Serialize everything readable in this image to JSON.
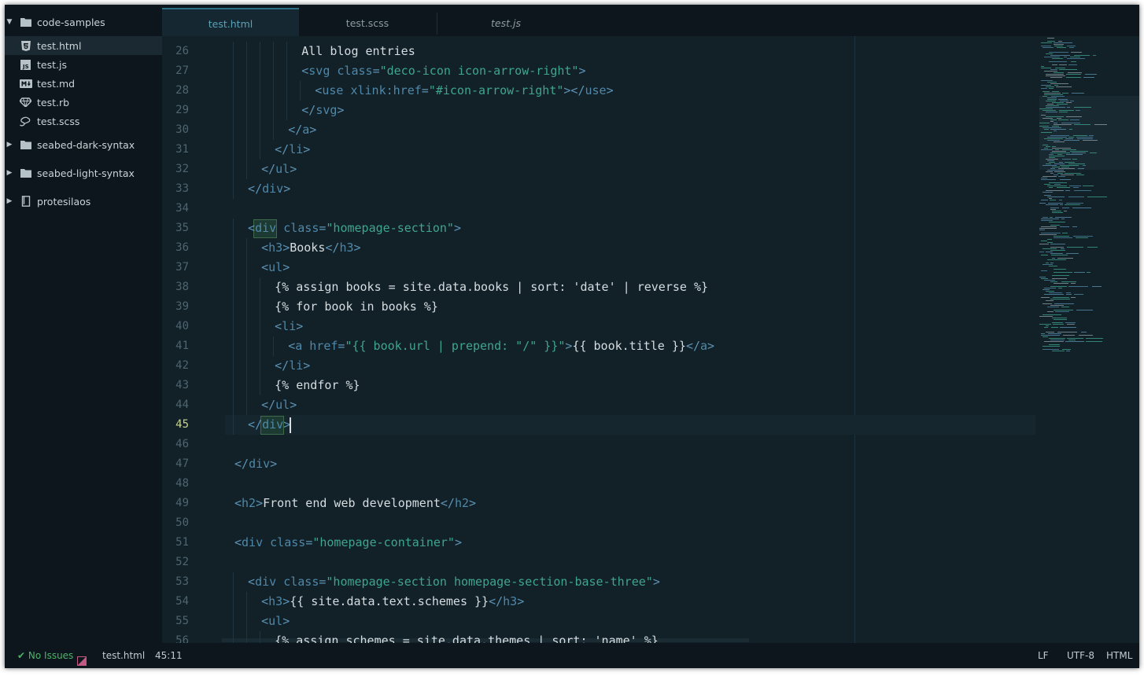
{
  "sidebar": {
    "root": {
      "label": "code-samples",
      "icon": "folder-icon",
      "expanded": true
    },
    "files": [
      {
        "label": "test.html",
        "icon": "html5-icon",
        "selected": true
      },
      {
        "label": "test.js",
        "icon": "js-icon",
        "selected": false
      },
      {
        "label": "test.md",
        "icon": "markdown-icon",
        "selected": false
      },
      {
        "label": "test.rb",
        "icon": "ruby-icon",
        "selected": false
      },
      {
        "label": "test.scss",
        "icon": "sass-icon",
        "selected": false
      }
    ],
    "folders": [
      {
        "label": "seabed-dark-syntax",
        "icon": "folder-icon"
      },
      {
        "label": "seabed-light-syntax",
        "icon": "folder-icon"
      },
      {
        "label": "protesilaos",
        "icon": "repo-icon"
      }
    ]
  },
  "tabs": [
    {
      "label": "test.html",
      "active": true
    },
    {
      "label": "test.scss",
      "active": false
    },
    {
      "label": "test.js",
      "active": false
    }
  ],
  "editor": {
    "current_line": 45,
    "lines": [
      {
        "n": "26",
        "indent": 5,
        "tokens": [
          [
            "t",
            "All blog entries"
          ]
        ]
      },
      {
        "n": "27",
        "indent": 5,
        "tokens": [
          [
            "b",
            "<"
          ],
          [
            "g",
            "svg"
          ],
          [
            "a",
            " class"
          ],
          [
            "b",
            "="
          ],
          [
            "s",
            "\"deco-icon icon-arrow-right\""
          ],
          [
            "b",
            ">"
          ]
        ]
      },
      {
        "n": "28",
        "indent": 6,
        "tokens": [
          [
            "b",
            "<"
          ],
          [
            "g",
            "use"
          ],
          [
            "a",
            " xlink:href"
          ],
          [
            "b",
            "="
          ],
          [
            "s",
            "\"#icon-arrow-right\""
          ],
          [
            "b",
            "></"
          ],
          [
            "g",
            "use"
          ],
          [
            "b",
            ">"
          ]
        ]
      },
      {
        "n": "29",
        "indent": 5,
        "tokens": [
          [
            "b",
            "</"
          ],
          [
            "g",
            "svg"
          ],
          [
            "b",
            ">"
          ]
        ]
      },
      {
        "n": "30",
        "indent": 4,
        "tokens": [
          [
            "b",
            "</"
          ],
          [
            "g",
            "a"
          ],
          [
            "b",
            ">"
          ]
        ]
      },
      {
        "n": "31",
        "indent": 3,
        "tokens": [
          [
            "b",
            "</"
          ],
          [
            "g",
            "li"
          ],
          [
            "b",
            ">"
          ]
        ]
      },
      {
        "n": "32",
        "indent": 2,
        "tokens": [
          [
            "b",
            "</"
          ],
          [
            "g",
            "ul"
          ],
          [
            "b",
            ">"
          ]
        ]
      },
      {
        "n": "33",
        "indent": 1,
        "tokens": [
          [
            "b",
            "</"
          ],
          [
            "g",
            "div"
          ],
          [
            "b",
            ">"
          ]
        ]
      },
      {
        "n": "34",
        "indent": 0,
        "tokens": []
      },
      {
        "n": "35",
        "indent": 1,
        "tokens": [
          [
            "b",
            "<"
          ],
          [
            "g",
            "div"
          ],
          [
            "a",
            " class"
          ],
          [
            "b",
            "="
          ],
          [
            "s",
            "\"homepage-section\""
          ],
          [
            "b",
            ">"
          ]
        ]
      },
      {
        "n": "36",
        "indent": 2,
        "tokens": [
          [
            "b",
            "<"
          ],
          [
            "g",
            "h3"
          ],
          [
            "b",
            ">"
          ],
          [
            "t",
            "Books"
          ],
          [
            "b",
            "</"
          ],
          [
            "g",
            "h3"
          ],
          [
            "b",
            ">"
          ]
        ]
      },
      {
        "n": "37",
        "indent": 2,
        "tokens": [
          [
            "b",
            "<"
          ],
          [
            "g",
            "ul"
          ],
          [
            "b",
            ">"
          ]
        ]
      },
      {
        "n": "38",
        "indent": 3,
        "tokens": [
          [
            "l",
            "{% assign books = site.data.books | sort: 'date' | reverse %}"
          ]
        ]
      },
      {
        "n": "39",
        "indent": 3,
        "tokens": [
          [
            "l",
            "{% for book in books %}"
          ]
        ]
      },
      {
        "n": "40",
        "indent": 3,
        "tokens": [
          [
            "b",
            "<"
          ],
          [
            "g",
            "li"
          ],
          [
            "b",
            ">"
          ]
        ]
      },
      {
        "n": "41",
        "indent": 4,
        "tokens": [
          [
            "b",
            "<"
          ],
          [
            "g",
            "a"
          ],
          [
            "a",
            " href"
          ],
          [
            "b",
            "="
          ],
          [
            "s",
            "\"{{ book.url | prepend: \"/\" }}\""
          ],
          [
            "b",
            ">"
          ],
          [
            "l",
            "{{ book.title }}"
          ],
          [
            "b",
            "</"
          ],
          [
            "g",
            "a"
          ],
          [
            "b",
            ">"
          ]
        ]
      },
      {
        "n": "42",
        "indent": 3,
        "tokens": [
          [
            "b",
            "</"
          ],
          [
            "g",
            "li"
          ],
          [
            "b",
            ">"
          ]
        ]
      },
      {
        "n": "43",
        "indent": 3,
        "tokens": [
          [
            "l",
            "{% endfor %}"
          ]
        ]
      },
      {
        "n": "44",
        "indent": 2,
        "tokens": [
          [
            "b",
            "</"
          ],
          [
            "g",
            "ul"
          ],
          [
            "b",
            ">"
          ]
        ]
      },
      {
        "n": "45",
        "indent": 1,
        "tokens": [
          [
            "b",
            "</"
          ],
          [
            "g",
            "div"
          ],
          [
            "b",
            ">"
          ]
        ]
      },
      {
        "n": "46",
        "indent": 0,
        "tokens": []
      },
      {
        "n": "47",
        "indent": 0,
        "tokens": [
          [
            "b",
            "</"
          ],
          [
            "g",
            "div"
          ],
          [
            "b",
            ">"
          ]
        ]
      },
      {
        "n": "48",
        "indent": 0,
        "tokens": []
      },
      {
        "n": "49",
        "indent": 0,
        "tokens": [
          [
            "b",
            "<"
          ],
          [
            "g",
            "h2"
          ],
          [
            "b",
            ">"
          ],
          [
            "t",
            "Front end web development"
          ],
          [
            "b",
            "</"
          ],
          [
            "g",
            "h2"
          ],
          [
            "b",
            ">"
          ]
        ]
      },
      {
        "n": "50",
        "indent": 0,
        "tokens": []
      },
      {
        "n": "51",
        "indent": 0,
        "tokens": [
          [
            "b",
            "<"
          ],
          [
            "g",
            "div"
          ],
          [
            "a",
            " class"
          ],
          [
            "b",
            "="
          ],
          [
            "s",
            "\"homepage-container\""
          ],
          [
            "b",
            ">"
          ]
        ]
      },
      {
        "n": "52",
        "indent": 0,
        "tokens": []
      },
      {
        "n": "53",
        "indent": 1,
        "tokens": [
          [
            "b",
            "<"
          ],
          [
            "g",
            "div"
          ],
          [
            "a",
            " class"
          ],
          [
            "b",
            "="
          ],
          [
            "s",
            "\"homepage-section homepage-section-base-three\""
          ],
          [
            "b",
            ">"
          ]
        ]
      },
      {
        "n": "54",
        "indent": 2,
        "tokens": [
          [
            "b",
            "<"
          ],
          [
            "g",
            "h3"
          ],
          [
            "b",
            ">"
          ],
          [
            "l",
            "{{ site.data.text.schemes }}"
          ],
          [
            "b",
            "</"
          ],
          [
            "g",
            "h3"
          ],
          [
            "b",
            ">"
          ]
        ]
      },
      {
        "n": "55",
        "indent": 2,
        "tokens": [
          [
            "b",
            "<"
          ],
          [
            "g",
            "ul"
          ],
          [
            "b",
            ">"
          ]
        ]
      },
      {
        "n": "56",
        "indent": 3,
        "tokens": [
          [
            "l",
            "{% assign schemes = site.data.themes | sort: 'name' %}"
          ]
        ]
      }
    ]
  },
  "status": {
    "issues": "No Issues",
    "file": "test.html",
    "cursor": "45:11",
    "line_ending": "LF",
    "encoding": "UTF-8",
    "grammar": "HTML"
  },
  "colors": {
    "background": "#122028",
    "sidebar": "#0c161c",
    "accent": "#5aa2b8",
    "string": "#3fa58f",
    "tag": "#4f88a8",
    "ok": "#4fb36a"
  }
}
